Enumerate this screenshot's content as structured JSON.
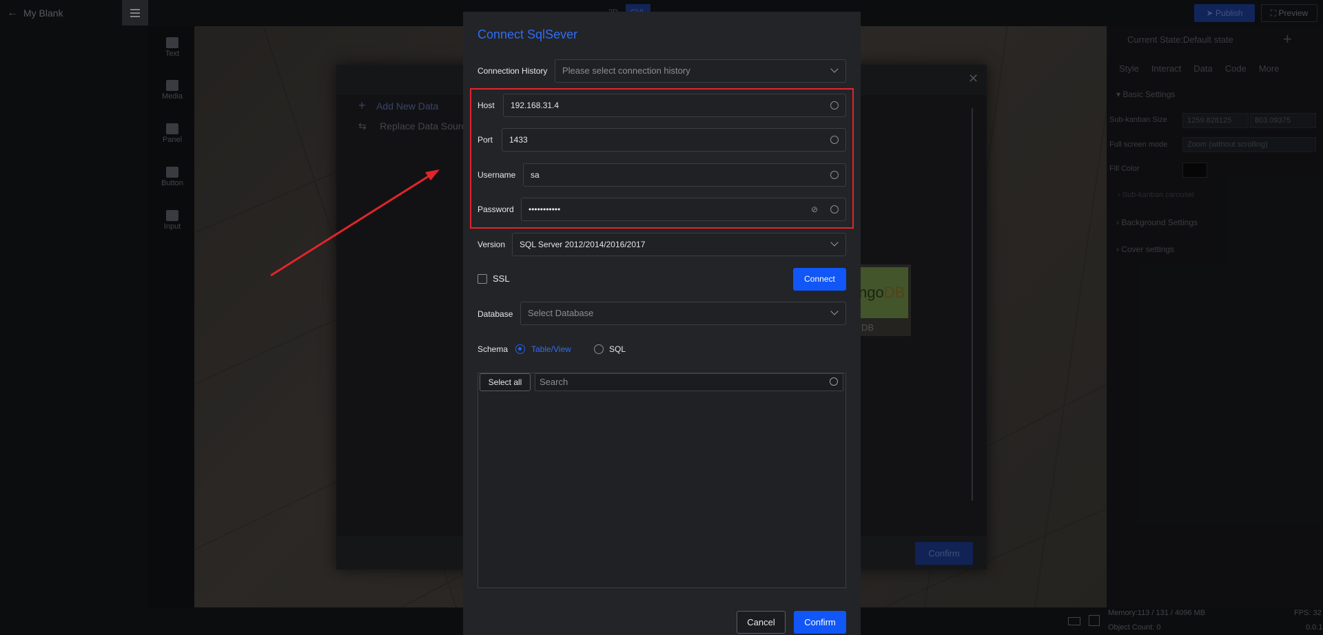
{
  "app": {
    "title": "My Blank",
    "modes": [
      "2D",
      "GVL"
    ],
    "publish": "Publish",
    "preview": "Preview"
  },
  "tools": [
    "Text",
    "Media",
    "Panel",
    "Button",
    "Input"
  ],
  "right_panel": {
    "state": "Current State:Default state",
    "tabs": [
      "Style",
      "Interact",
      "Data",
      "Code",
      "More"
    ],
    "basic_settings": "Basic Settings",
    "sub_kanban_size_label": "Sub-kanban Size",
    "width": "1259.828125",
    "height": "803.09375",
    "unit": "px",
    "full_screen_label": "Full screen mode",
    "full_screen_value": "Zoom (without scrolling)",
    "fill_color_label": "Fill Color",
    "carousel": "Sub-kanban carousel",
    "background_settings": "Background Settings",
    "cover_settings": "Cover settings"
  },
  "status": {
    "memory": "Memory:113 / 131 / 4096 MB",
    "objects": "Object Count: 0",
    "fps": "FPS: 32",
    "version": "0.0.1"
  },
  "bg_dialog": {
    "add_new": "Add New Data",
    "replace": "Replace Data Sourc",
    "confirm": "Confirm",
    "mongo_logo": "ngo",
    "mongo_logo_db": "DB",
    "mongo_label": "DB"
  },
  "modal": {
    "title": "Connect SqlSever",
    "history_label": "Connection History",
    "history_placeholder": "Please select connection history",
    "host_label": "Host",
    "host_value": "192.168.31.4",
    "port_label": "Port",
    "port_value": "1433",
    "username_label": "Username",
    "username_value": "sa",
    "password_label": "Password",
    "password_value": "•••••••••••",
    "version_label": "Version",
    "version_value": "SQL Server 2012/2014/2016/2017",
    "ssl_label": "SSL",
    "connect_button": "Connect",
    "database_label": "Database",
    "database_placeholder": "Select Database",
    "schema_label": "Schema",
    "schema_option_table": "Table/View",
    "schema_option_sql": "SQL",
    "select_all": "Select all",
    "search_placeholder": "Search",
    "cancel": "Cancel",
    "confirm": "Confirm"
  },
  "colors": {
    "accent": "#1156f6",
    "highlight": "#e2252b",
    "modal_bg": "#232428"
  }
}
